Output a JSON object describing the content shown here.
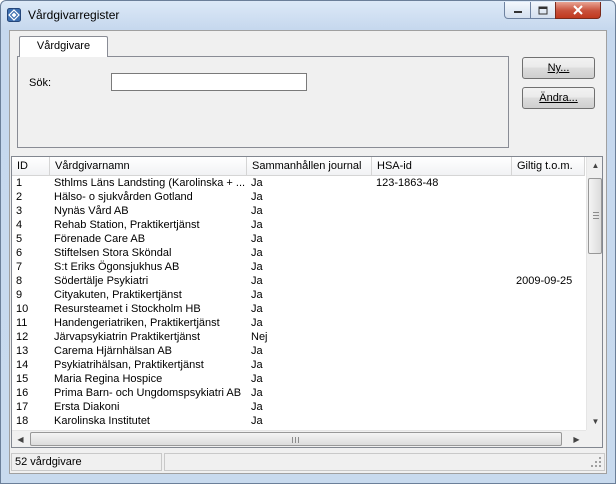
{
  "window": {
    "title": "Vårdgivarregister",
    "icon": "diamond-app-icon"
  },
  "tabs": [
    {
      "label": "Vårdgivare"
    }
  ],
  "search": {
    "label": "Sök:",
    "value": "",
    "placeholder": ""
  },
  "buttons": {
    "new_label": "Ny...",
    "edit_label": "Ändra..."
  },
  "table": {
    "columns": [
      "ID",
      "Vårdgivarnamn",
      "Sammanhållen journal",
      "HSA-id",
      "Giltig t.o.m."
    ],
    "rows": [
      [
        "1",
        "Sthlms Läns Landsting (Karolinska + ...",
        "Ja",
        "123-1863-48",
        ""
      ],
      [
        "2",
        "Hälso- o sjukvården Gotland",
        "Ja",
        "",
        ""
      ],
      [
        "3",
        "Nynäs Vård AB",
        "Ja",
        "",
        ""
      ],
      [
        "4",
        "Rehab Station, Praktikertjänst",
        "Ja",
        "",
        ""
      ],
      [
        "5",
        "Förenade Care AB",
        "Ja",
        "",
        ""
      ],
      [
        "6",
        "Stiftelsen Stora Sköndal",
        "Ja",
        "",
        ""
      ],
      [
        "7",
        "S:t Eriks Ögonsjukhus AB",
        "Ja",
        "",
        ""
      ],
      [
        "8",
        "Södertälje Psykiatri",
        "Ja",
        "",
        "2009-09-25"
      ],
      [
        "9",
        "Cityakuten, Praktikertjänst",
        "Ja",
        "",
        ""
      ],
      [
        "10",
        "Resursteamet i Stockholm HB",
        "Ja",
        "",
        ""
      ],
      [
        "11",
        "Handengeriatriken, Praktikertjänst",
        "Ja",
        "",
        ""
      ],
      [
        "12",
        "Järvapsykiatrin Praktikertjänst",
        "Nej",
        "",
        ""
      ],
      [
        "13",
        "Carema Hjärnhälsan AB",
        "Ja",
        "",
        ""
      ],
      [
        "14",
        "Psykiatrihälsan, Praktikertjänst",
        "Ja",
        "",
        ""
      ],
      [
        "15",
        "Maria Regina Hospice",
        "Ja",
        "",
        ""
      ],
      [
        "16",
        "Prima Barn- och Ungdomspsykiatri AB",
        "Ja",
        "",
        ""
      ],
      [
        "17",
        "Ersta Diakoni",
        "Ja",
        "",
        ""
      ],
      [
        "18",
        "Karolinska Institutet",
        "Ja",
        "",
        ""
      ]
    ]
  },
  "status": {
    "count_text": "52 vårdgivare"
  }
}
